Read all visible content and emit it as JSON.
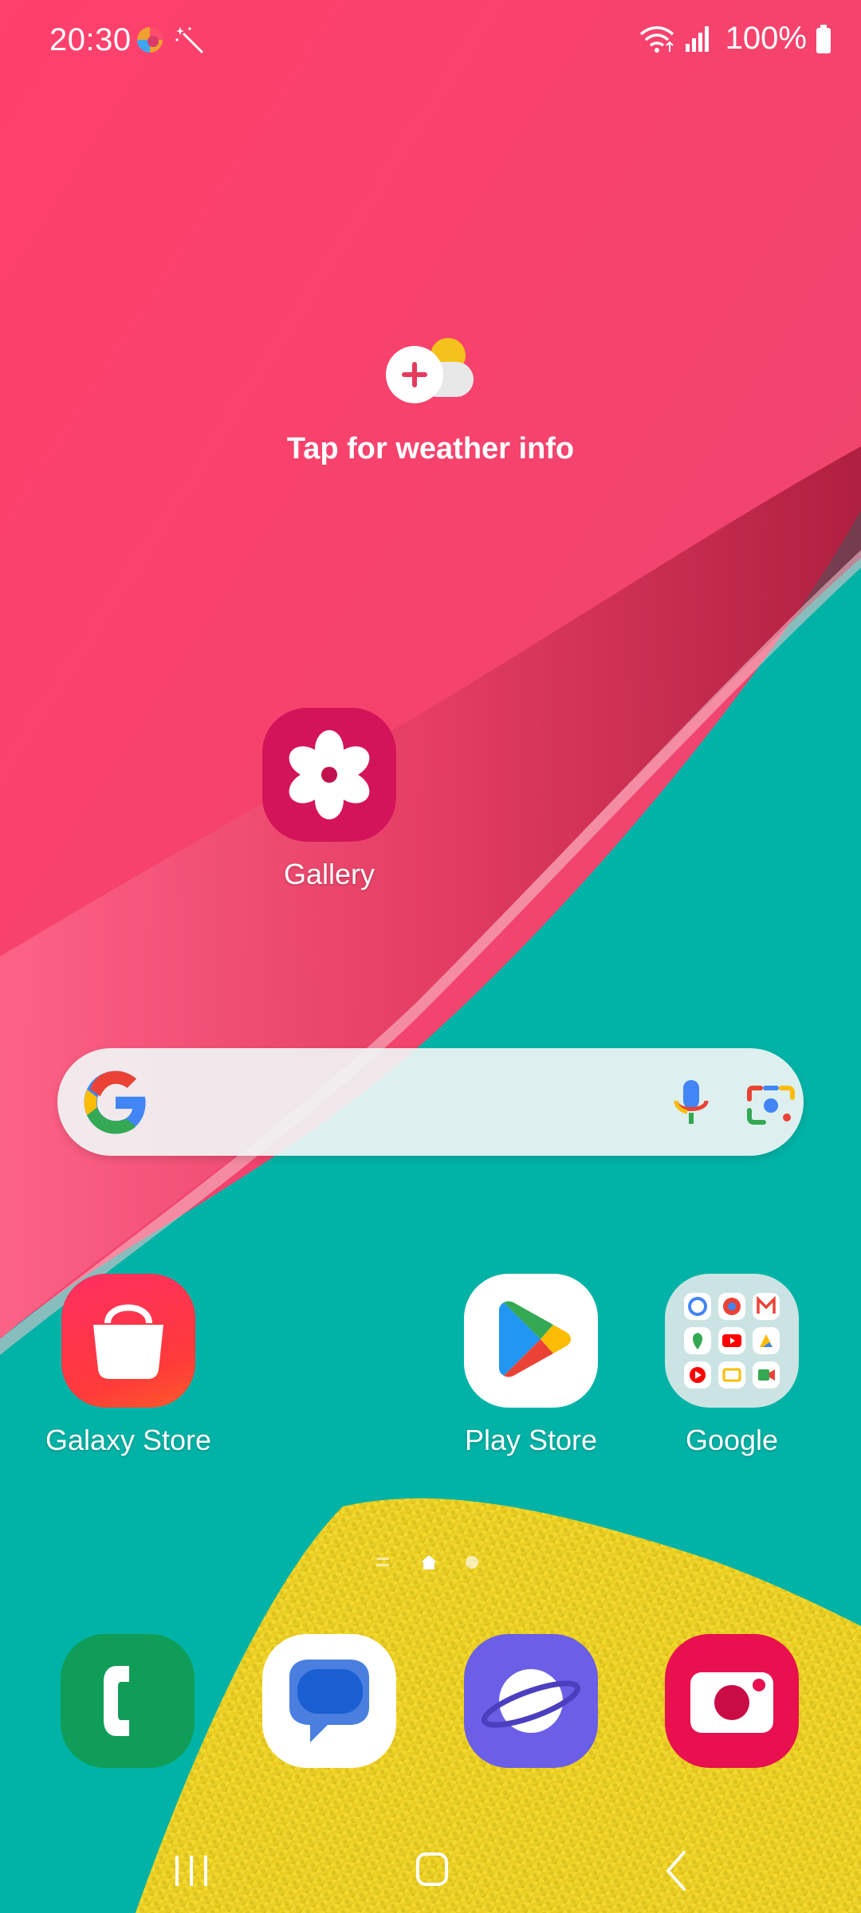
{
  "status_bar": {
    "time": "20:30",
    "left_icons": [
      "multicolor-app-icon",
      "magic-wand-icon"
    ],
    "right_icons": [
      "wifi-icon",
      "signal-icon",
      "battery-icon"
    ],
    "battery": "100%"
  },
  "weather_widget": {
    "icon": "weather-add-icon",
    "text": "Tap for weather info"
  },
  "home_apps": {
    "gallery": {
      "label": "Gallery",
      "icon": "gallery-flower-icon"
    },
    "galaxy_store": {
      "label": "Galaxy Store",
      "icon": "shopping-bag-icon"
    },
    "play_store": {
      "label": "Play Store",
      "icon": "play-store-icon"
    },
    "google_folder": {
      "label": "Google",
      "icon": "google-apps-folder-icon"
    }
  },
  "search_bar": {
    "icons": [
      "google-g-icon",
      "microphone-icon",
      "google-lens-icon"
    ]
  },
  "page_indicator": {
    "pages": 3,
    "current": 1
  },
  "dock": [
    {
      "name": "Phone",
      "icon": "phone-icon"
    },
    {
      "name": "Messages",
      "icon": "messages-icon"
    },
    {
      "name": "Internet",
      "icon": "samsung-internet-icon"
    },
    {
      "name": "Camera",
      "icon": "camera-icon"
    }
  ],
  "nav_bar": [
    "recents-icon",
    "home-icon",
    "back-icon"
  ],
  "colors": {
    "wallpaper_pink": "#ff4770",
    "wallpaper_teal": "#00b3a6",
    "wallpaper_yellow": "#e8cd1e",
    "text": "#ffffff"
  }
}
